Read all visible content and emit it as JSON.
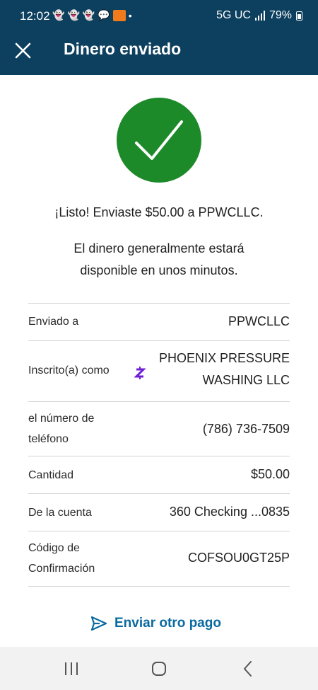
{
  "status_bar": {
    "time": "12:02",
    "network": "5G UC",
    "battery": "79%"
  },
  "header": {
    "title": "Dinero enviado",
    "close_icon": "close-icon"
  },
  "confirmation": {
    "icon": "checkmark-icon",
    "icon_color": "#1d8a2a",
    "message": "¡Listo! Enviaste $50.00 a PPWCLLC.",
    "availability_line1": "El dinero generalmente estará",
    "availability_line2": "disponible en unos minutos."
  },
  "details": {
    "sent_to_label": "Enviado a",
    "sent_to_value": "PPWCLLC",
    "enrolled_label": "Inscrito(a) como",
    "enrolled_icon": "zelle-icon",
    "enrolled_value_line1": "PHOENIX PRESSURE",
    "enrolled_value_line2": "WASHING LLC",
    "phone_label_line1": "el número de",
    "phone_label_line2": "teléfono",
    "phone_value": "(786) 736-7509",
    "amount_label": "Cantidad",
    "amount_value": "$50.00",
    "account_label": "De la cuenta",
    "account_value": "360 Checking ...0835",
    "code_label_line1": "Código de",
    "code_label_line2": "Confirmación",
    "code_value": "COFSOU0GT25P"
  },
  "actions": {
    "send_again_label": "Enviar otro pago",
    "send_again_icon": "send-icon"
  },
  "navigation": {
    "recents_icon": "recents-icon",
    "home_icon": "home-icon",
    "back_icon": "back-icon"
  },
  "colors": {
    "header_bg": "#0d3f5e",
    "accent": "#0a6aa0",
    "zelle": "#6d1ed4"
  }
}
